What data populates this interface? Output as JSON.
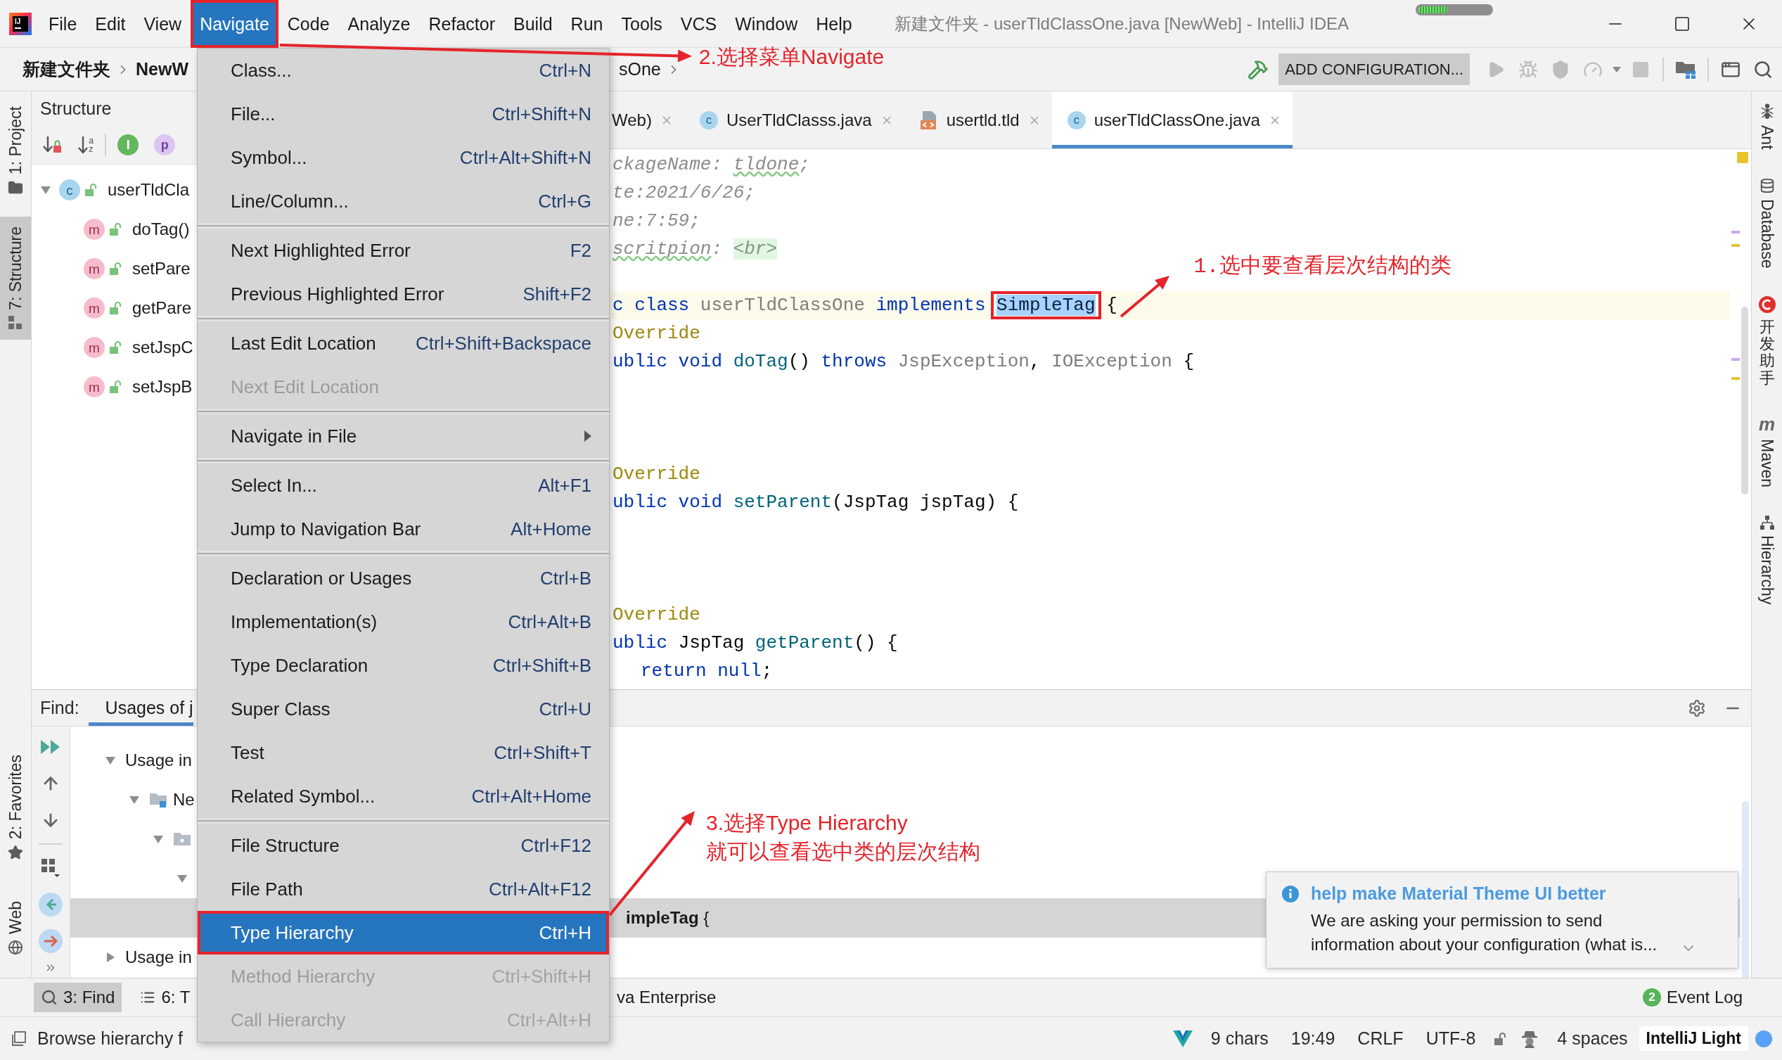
{
  "app_logo": {
    "text": "IJ"
  },
  "menu_bar": [
    {
      "label": "File",
      "selected": false
    },
    {
      "label": "Edit",
      "selected": false
    },
    {
      "label": "View",
      "selected": false
    },
    {
      "label": "Navigate",
      "selected": true
    },
    {
      "label": "Code",
      "selected": false
    },
    {
      "label": "Analyze",
      "selected": false
    },
    {
      "label": "Refactor",
      "selected": false
    },
    {
      "label": "Build",
      "selected": false
    },
    {
      "label": "Run",
      "selected": false
    },
    {
      "label": "Tools",
      "selected": false
    },
    {
      "label": "VCS",
      "selected": false
    },
    {
      "label": "Window",
      "selected": false
    },
    {
      "label": "Help",
      "selected": false
    }
  ],
  "window": {
    "title": "新建文件夹 - userTldClassOne.java [NewWeb] - IntelliJ IDEA"
  },
  "memory_indicator": {
    "level": 0.4
  },
  "nav_bar": {
    "crumbs_left": [
      {
        "label": "新建文件夹",
        "chevron": true
      },
      {
        "label": "NewW",
        "chevron": false
      }
    ],
    "crumbs_right": [
      {
        "label": "sOne",
        "chevron": true
      }
    ]
  },
  "run_toolbar": {
    "actions_before": [
      {
        "kind": "build",
        "disabled": false
      }
    ],
    "configuration": "ADD CONFIGURATION...",
    "actions_after": [
      {
        "kind": "run",
        "disabled": true
      },
      {
        "kind": "debug",
        "disabled": true
      },
      {
        "kind": "coverage",
        "disabled": true
      },
      {
        "kind": "profile",
        "disabled": true
      },
      {
        "kind": "stop",
        "disabled": true
      },
      {
        "kind": "project-structure",
        "disabled": false
      },
      {
        "kind": "layout",
        "disabled": false
      },
      {
        "kind": "search",
        "disabled": false
      }
    ]
  },
  "left_strip": {
    "top": [
      {
        "label": "1: Project",
        "kind": "project",
        "selected": false
      },
      {
        "label": "7: Structure",
        "kind": "structure",
        "selected": true
      }
    ],
    "bottom": [
      {
        "label": "2: Favorites",
        "kind": "favorites",
        "selected": false
      },
      {
        "label": "Web",
        "kind": "web",
        "selected": false
      }
    ]
  },
  "structure": {
    "title": "Structure",
    "tools": [
      {
        "kind": "sort-visibility"
      },
      {
        "kind": "sort-alpha",
        "glyph": "az"
      },
      {
        "kind": "inherited",
        "glyph": "I"
      },
      {
        "kind": "properties",
        "glyph": "p"
      }
    ],
    "tree": [
      {
        "kind": "class",
        "badge": "c",
        "label": "userTldCla",
        "expanded": true,
        "children": [
          {
            "kind": "method",
            "badge": "m",
            "label": "doTag()"
          },
          {
            "kind": "method",
            "badge": "m",
            "label": "setPare"
          },
          {
            "kind": "method",
            "badge": "m",
            "label": "getPare"
          },
          {
            "kind": "method",
            "badge": "m",
            "label": "setJspC"
          },
          {
            "kind": "method",
            "badge": "m",
            "label": "setJspB"
          }
        ]
      }
    ]
  },
  "editor": {
    "tabs": [
      {
        "label": "Web)",
        "selected": false
      },
      {
        "label": "UserTldClasss.java",
        "kind": "java",
        "badge": "c",
        "selected": false
      },
      {
        "label": "usertld.tld",
        "kind": "tld",
        "selected": false
      },
      {
        "label": "userTldClassOne.java",
        "kind": "java",
        "badge": "c",
        "selected": true
      }
    ],
    "lines": [
      {
        "kind": "code",
        "current": false,
        "tokens": [
          {
            "kind": "comment",
            "text": "ckageName: "
          },
          {
            "kind": "comment-typo",
            "text": "tldone"
          },
          {
            "kind": "comment",
            "text": ";"
          }
        ]
      },
      {
        "kind": "code",
        "current": false,
        "tokens": [
          {
            "kind": "comment",
            "text": "te:2021/6/26;"
          }
        ]
      },
      {
        "kind": "code",
        "current": false,
        "tokens": [
          {
            "kind": "comment",
            "text": "ne:7:59;"
          }
        ]
      },
      {
        "kind": "code",
        "current": false,
        "tokens": [
          {
            "kind": "comment-typo",
            "text": "scritpion"
          },
          {
            "kind": "comment",
            "text": ": "
          },
          {
            "kind": "doc-tag",
            "text": "<br>"
          }
        ]
      },
      {
        "kind": "blank"
      },
      {
        "kind": "code",
        "current": true,
        "tokens": [
          {
            "kind": "keyword",
            "text": "c class "
          },
          {
            "kind": "unused",
            "text": "userTldClassOne"
          },
          {
            "kind": "keyword",
            "text": " implements "
          },
          {
            "kind": "selection",
            "text": "SimpleTag"
          },
          {
            "kind": "plain",
            "text": " {"
          }
        ]
      },
      {
        "kind": "code",
        "current": false,
        "tokens": [
          {
            "kind": "annotation",
            "text": "Override"
          }
        ]
      },
      {
        "kind": "code",
        "current": false,
        "tokens": [
          {
            "kind": "keyword",
            "text": "ublic void "
          },
          {
            "kind": "method",
            "text": "doTag"
          },
          {
            "kind": "plain",
            "text": "() "
          },
          {
            "kind": "keyword",
            "text": "throws "
          },
          {
            "kind": "unused",
            "text": "JspException"
          },
          {
            "kind": "plain",
            "text": ", "
          },
          {
            "kind": "unused",
            "text": "IOException"
          },
          {
            "kind": "plain",
            "text": " {"
          }
        ]
      },
      {
        "kind": "blank"
      },
      {
        "kind": "blank"
      },
      {
        "kind": "blank"
      },
      {
        "kind": "code",
        "current": false,
        "tokens": [
          {
            "kind": "annotation",
            "text": "Override"
          }
        ]
      },
      {
        "kind": "code",
        "current": false,
        "tokens": [
          {
            "kind": "keyword",
            "text": "ublic void "
          },
          {
            "kind": "method",
            "text": "setParent"
          },
          {
            "kind": "plain",
            "text": "(JspTag jspTag) {"
          }
        ]
      },
      {
        "kind": "blank"
      },
      {
        "kind": "blank"
      },
      {
        "kind": "blank"
      },
      {
        "kind": "code",
        "current": false,
        "tokens": [
          {
            "kind": "annotation",
            "text": "Override"
          }
        ]
      },
      {
        "kind": "code",
        "current": false,
        "tokens": [
          {
            "kind": "keyword",
            "text": "ublic "
          },
          {
            "kind": "plain",
            "text": "JspTag "
          },
          {
            "kind": "method",
            "text": "getParent"
          },
          {
            "kind": "plain",
            "text": "() {"
          }
        ],
        "children": [
          {
            "kind": "code",
            "current": false,
            "tokens": [
              {
                "kind": "keyword",
                "text": "return null"
              },
              {
                "kind": "plain",
                "text": ";"
              }
            ]
          }
        ]
      }
    ]
  },
  "find": {
    "title": "Find:",
    "tabs": [
      {
        "label": "Usages of j",
        "selected": true
      }
    ],
    "tree": [
      {
        "label": "Usage in",
        "expanded": true,
        "selected": false,
        "children": [
          {
            "kind": "module",
            "label": "Ne",
            "expanded": true,
            "selected": false,
            "children": [
              {
                "kind": "package",
                "expanded": true,
                "selected": false,
                "children": [
                  {
                    "expanded": true,
                    "selected": false,
                    "children": [
                      {
                        "kind": "usage",
                        "text": "**impleTag** {",
                        "selected": true
                      }
                    ]
                  }
                ]
              }
            ]
          }
        ]
      },
      {
        "label": "Usage in",
        "expanded": false,
        "selected": false
      }
    ]
  },
  "notification": {
    "title": "help make Material Theme UI better",
    "body": "We are asking your permission to send information about your configuration (what is..."
  },
  "right_strip": [
    {
      "label": "Ant",
      "kind": "ant"
    },
    {
      "label": "Database",
      "kind": "database"
    },
    {
      "label": "开发助手",
      "kind": "assistant"
    },
    {
      "label": "Maven",
      "kind": "maven",
      "glyph": "m"
    },
    {
      "label": "Hierarchy",
      "kind": "hierarchy"
    }
  ],
  "bottom_bar": {
    "left_tools": [
      {
        "label": "3: Find",
        "kind": "find",
        "selected": true
      },
      {
        "label": "6: T",
        "kind": "todo",
        "selected": false
      }
    ],
    "middle_tools": [
      {
        "label": "va Enterprise",
        "selected": false
      }
    ],
    "event_log": {
      "label": "Event Log",
      "badge": "2"
    }
  },
  "status_bar": {
    "message": "Browse hierarchy f",
    "selection": "9 chars",
    "position": "19:49",
    "line_separator": "CRLF",
    "encoding": "UTF-8",
    "indent": "4 spaces",
    "theme": "IntelliJ Light"
  },
  "navigate_menu": {
    "groups": [
      {
        "items": [
          {
            "kind": "action",
            "label": "Class...",
            "shortcut": "Ctrl+N",
            "disabled": false,
            "selected": false
          },
          {
            "kind": "action",
            "label": "File...",
            "shortcut": "Ctrl+Shift+N",
            "disabled": false,
            "selected": false
          },
          {
            "kind": "action",
            "label": "Symbol...",
            "shortcut": "Ctrl+Alt+Shift+N",
            "disabled": false,
            "selected": false
          },
          {
            "kind": "action",
            "label": "Line/Column...",
            "shortcut": "Ctrl+G",
            "disabled": false,
            "selected": false
          }
        ]
      },
      {
        "items": [
          {
            "kind": "action",
            "label": "Next Highlighted Error",
            "shortcut": "F2",
            "disabled": false,
            "selected": false
          },
          {
            "kind": "action",
            "label": "Previous Highlighted Error",
            "shortcut": "Shift+F2",
            "disabled": false,
            "selected": false
          }
        ]
      },
      {
        "items": [
          {
            "kind": "action",
            "label": "Last Edit Location",
            "shortcut": "Ctrl+Shift+Backspace",
            "disabled": false,
            "selected": false
          },
          {
            "kind": "action",
            "label": "Next Edit Location",
            "disabled": true,
            "selected": false
          }
        ]
      },
      {
        "items": [
          {
            "kind": "submenu",
            "label": "Navigate in File",
            "disabled": false,
            "selected": false
          }
        ]
      },
      {
        "items": [
          {
            "kind": "action",
            "label": "Select In...",
            "shortcut": "Alt+F1",
            "disabled": false,
            "selected": false
          },
          {
            "kind": "action",
            "label": "Jump to Navigation Bar",
            "shortcut": "Alt+Home",
            "disabled": false,
            "selected": false
          }
        ]
      },
      {
        "items": [
          {
            "kind": "action",
            "label": "Declaration or Usages",
            "shortcut": "Ctrl+B",
            "disabled": false,
            "selected": false
          },
          {
            "kind": "action",
            "label": "Implementation(s)",
            "shortcut": "Ctrl+Alt+B",
            "disabled": false,
            "selected": false
          },
          {
            "kind": "action",
            "label": "Type Declaration",
            "shortcut": "Ctrl+Shift+B",
            "disabled": false,
            "selected": false
          },
          {
            "kind": "action",
            "label": "Super Class",
            "shortcut": "Ctrl+U",
            "disabled": false,
            "selected": false
          },
          {
            "kind": "action",
            "label": "Test",
            "shortcut": "Ctrl+Shift+T",
            "disabled": false,
            "selected": false
          },
          {
            "kind": "action",
            "label": "Related Symbol...",
            "shortcut": "Ctrl+Alt+Home",
            "disabled": false,
            "selected": false
          }
        ]
      },
      {
        "items": [
          {
            "kind": "action",
            "label": "File Structure",
            "shortcut": "Ctrl+F12",
            "disabled": false,
            "selected": false
          },
          {
            "kind": "action",
            "label": "File Path",
            "shortcut": "Ctrl+Alt+F12",
            "disabled": false,
            "selected": false
          },
          {
            "kind": "action",
            "label": "Type Hierarchy",
            "shortcut": "Ctrl+H",
            "disabled": false,
            "selected": true
          },
          {
            "kind": "action",
            "label": "Method Hierarchy",
            "shortcut": "Ctrl+Shift+H",
            "disabled": true,
            "selected": false
          },
          {
            "kind": "action",
            "label": "Call Hierarchy",
            "shortcut": "Ctrl+Alt+H",
            "disabled": true,
            "selected": false
          }
        ]
      }
    ]
  },
  "annotations": [
    {
      "kind": "menubar",
      "lines": [
        "2.选择菜单Navigate"
      ]
    },
    {
      "kind": "code",
      "lines": [
        "1.选中要查看层次结构的类"
      ]
    },
    {
      "kind": "menuitem",
      "lines": [
        "3.选择Type Hierarchy",
        "就可以查看选中类的层次结构"
      ]
    }
  ]
}
